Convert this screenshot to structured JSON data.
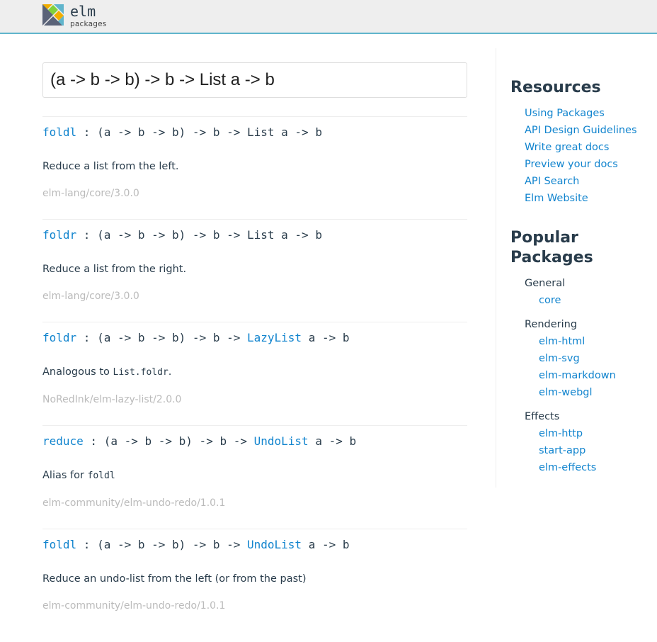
{
  "header": {
    "logo_name": "elm",
    "logo_sub": "packages",
    "accent": "#60b5cc"
  },
  "search": {
    "value": "(a -> b -> b) -> b -> List a -> b"
  },
  "results": [
    {
      "name": "foldl",
      "sig_pre": " : (a -> b -> b) -> b -> List a -> b",
      "type_link": "",
      "sig_post": "",
      "desc_pre": "Reduce a list from the left.",
      "desc_code": "",
      "desc_post": "",
      "package": "elm-lang/core/3.0.0"
    },
    {
      "name": "foldr",
      "sig_pre": " : (a -> b -> b) -> b -> List a -> b",
      "type_link": "",
      "sig_post": "",
      "desc_pre": "Reduce a list from the right.",
      "desc_code": "",
      "desc_post": "",
      "package": "elm-lang/core/3.0.0"
    },
    {
      "name": "foldr",
      "sig_pre": " : (a -> b -> b) -> b -> ",
      "type_link": "LazyList",
      "sig_post": " a -> b",
      "desc_pre": "Analogous to ",
      "desc_code": "List.foldr",
      "desc_post": ".",
      "package": "NoRedInk/elm-lazy-list/2.0.0"
    },
    {
      "name": "reduce",
      "sig_pre": " : (a -> b -> b) -> b -> ",
      "type_link": "UndoList",
      "sig_post": " a -> b",
      "desc_pre": "Alias for ",
      "desc_code": "foldl",
      "desc_post": "",
      "package": "elm-community/elm-undo-redo/1.0.1"
    },
    {
      "name": "foldl",
      "sig_pre": " : (a -> b -> b) -> b -> ",
      "type_link": "UndoList",
      "sig_post": " a -> b",
      "desc_pre": "Reduce an undo-list from the left (or from the past)",
      "desc_code": "",
      "desc_post": "",
      "package": "elm-community/elm-undo-redo/1.0.1"
    }
  ],
  "sidebar": {
    "resources_title": "Resources",
    "resources": [
      "Using Packages",
      "API Design Guidelines",
      "Write great docs",
      "Preview your docs",
      "API Search",
      "Elm Website"
    ],
    "popular_title": "Popular Packages",
    "categories": [
      {
        "name": "General",
        "packages": [
          "core"
        ]
      },
      {
        "name": "Rendering",
        "packages": [
          "elm-html",
          "elm-svg",
          "elm-markdown",
          "elm-webgl"
        ]
      },
      {
        "name": "Effects",
        "packages": [
          "elm-http",
          "start-app",
          "elm-effects"
        ]
      }
    ]
  },
  "colors": {
    "link": "#1184ce",
    "text": "#293c4b",
    "muted": "#bbbbbb",
    "header_bg": "#eeeeee"
  }
}
